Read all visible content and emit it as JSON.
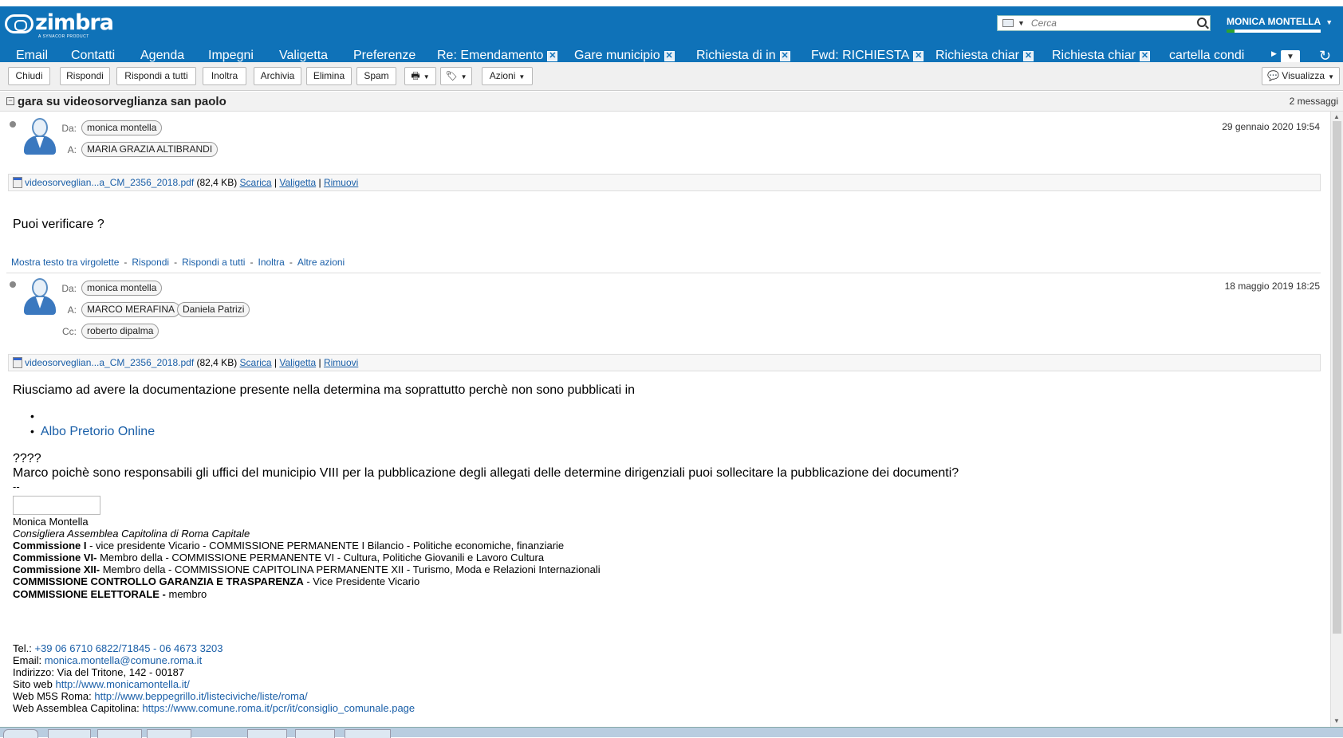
{
  "app": {
    "logo_text": "zimbra",
    "logo_sub": "A SYNACOR PRODUCT",
    "search_placeholder": "Cerca",
    "user_name": "MONICA MONTELLA",
    "brand_color": "#0f72b8"
  },
  "tabs": [
    {
      "label": "Email"
    },
    {
      "label": "Contatti"
    },
    {
      "label": "Agenda"
    },
    {
      "label": "Impegni"
    },
    {
      "label": "Valigetta"
    },
    {
      "label": "Preferenze"
    },
    {
      "label": "Re: Emendamento",
      "closable": true
    },
    {
      "label": "Gare municipio",
      "closable": true
    },
    {
      "label": "Richiesta di in",
      "closable": true
    },
    {
      "label": "Fwd: RICHIESTA",
      "closable": true
    },
    {
      "label": "Richiesta chiar",
      "closable": true
    },
    {
      "label": "Richiesta chiar",
      "closable": true
    },
    {
      "label": "cartella condi"
    }
  ],
  "toolbar": {
    "close": "Chiudi",
    "reply": "Rispondi",
    "reply_all": "Rispondi a tutti",
    "forward": "Inoltra",
    "archive": "Archivia",
    "delete": "Elimina",
    "spam": "Spam",
    "actions": "Azioni",
    "view": "Visualizza"
  },
  "conversation": {
    "subject": "gara su videosorveglianza san paolo",
    "count": "2 messaggi"
  },
  "messages": [
    {
      "from_label": "Da:",
      "to_label": "A:",
      "from": "monica montella",
      "to": [
        "MARIA GRAZIA ALTIBRANDI"
      ],
      "date": "29 gennaio 2020 19:54",
      "attachment": {
        "name": "videosorveglian...a_CM_2356_2018.pdf",
        "size": "(82,4 KB)",
        "download": "Scarica",
        "briefcase": "Valigetta",
        "remove": "Rimuovi"
      },
      "body": "Puoi verificare ?",
      "footer_links": [
        "Mostra testo tra virgolette",
        "Rispondi",
        "Rispondi a tutti",
        "Inoltra",
        "Altre azioni"
      ]
    },
    {
      "from_label": "Da:",
      "to_label": "A:",
      "cc_label": "Cc:",
      "from": "monica montella",
      "to": [
        "MARCO MERAFINA",
        "Daniela Patrizi"
      ],
      "cc": [
        "roberto dipalma"
      ],
      "date": "18 maggio 2019 18:25",
      "attachment": {
        "name": "videosorveglian...a_CM_2356_2018.pdf",
        "size": "(82,4 KB)",
        "download": "Scarica",
        "briefcase": "Valigetta",
        "remove": "Rimuovi"
      },
      "body_line1": "Riusciamo ad avere la documentazione presente nella determina ma soprattutto perchè non sono pubblicati in",
      "bullet_link": "Albo Pretorio Online",
      "body_q": "????",
      "body_line2": "Marco poichè sono responsabili gli uffici del municipio VIII per la pubblicazione degli allegati delle determine dirigenziali puoi sollecitare la pubblicazione dei documenti?",
      "sig_sep": "--",
      "signature": {
        "name": "Monica Montella",
        "role": "Consigliera Assemblea Capitolina di Roma Capitale",
        "c1_b": "Commissione I",
        "c1": " - vice presidente Vicario - COMMISSIONE PERMANENTE I Bilancio - Politiche economiche, finanziarie",
        "c6_b": "Commissione VI-",
        "c6": " Membro della - COMMISSIONE PERMANENTE VI - Cultura, Politiche Giovanili e Lavoro Cultura",
        "c12_b": "Commissione XII-",
        "c12": " Membro della - COMMISSIONE CAPITOLINA PERMANENTE XII - Turismo, Moda e Relazioni Internazionali",
        "cg_b": "COMMISSIONE CONTROLLO GARANZIA E TRASPARENZA",
        "cg": " - Vice Presidente Vicario",
        "ce_b": "COMMISSIONE ELETTORALE -",
        "ce": " membro",
        "tel_label": "Tel.: ",
        "tel": "+39 06 6710 6822/71845 - 06 4673 3203",
        "email_label": "Email: ",
        "email": "monica.montella@comune.roma.it",
        "address": "Indirizzo: Via del Tritone, 142 - 00187",
        "site_label": "Sito web ",
        "site": "http://www.monicamontella.it/",
        "m5s_label": "Web M5S Roma: ",
        "m5s": "http://www.beppegrillo.it/listeciviche/liste/roma/",
        "assembly_label": "Web Assemblea Capitolina: ",
        "assembly": "https://www.comune.roma.it/pcr/it/consiglio_comunale.page"
      }
    }
  ]
}
